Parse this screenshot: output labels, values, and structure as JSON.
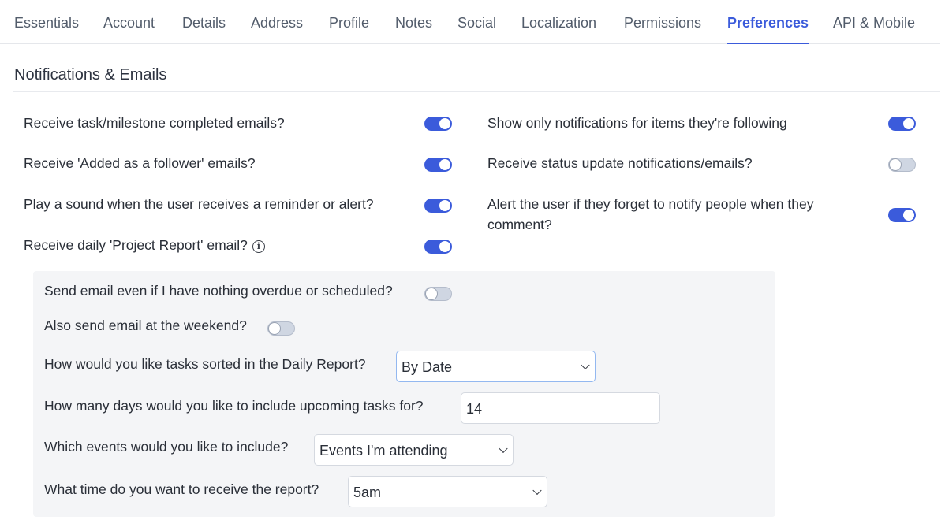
{
  "tabs": [
    {
      "label": "Essentials"
    },
    {
      "label": "Account"
    },
    {
      "label": "Details"
    },
    {
      "label": "Address"
    },
    {
      "label": "Profile"
    },
    {
      "label": "Notes"
    },
    {
      "label": "Social"
    },
    {
      "label": "Localization"
    },
    {
      "label": "Permissions"
    },
    {
      "label": "Preferences",
      "active": true
    },
    {
      "label": "API & Mobile"
    }
  ],
  "section": {
    "title": "Notifications & Emails"
  },
  "left_settings": [
    {
      "label": "Receive task/milestone completed emails?",
      "enabled": true
    },
    {
      "label": "Receive 'Added as a follower' emails?",
      "enabled": true
    },
    {
      "label": "Play a sound when the user receives a reminder or alert?",
      "enabled": true
    },
    {
      "label": "Receive daily 'Project Report' email?",
      "enabled": true
    }
  ],
  "right_settings": [
    {
      "label": "Show only notifications for items they're following",
      "enabled": true
    },
    {
      "label": "Receive status update notifications/emails?",
      "enabled": false
    },
    {
      "label": "Alert the user if they forget to notify people when they comment?",
      "enabled": true
    }
  ],
  "daily_report": {
    "nothing_overdue": {
      "label": "Send email even if I have nothing overdue or scheduled?",
      "enabled": false
    },
    "weekend": {
      "label": "Also send email at the weekend?",
      "enabled": false
    },
    "sort": {
      "label": "How would you like tasks sorted in the Daily Report?",
      "value": "By Date"
    },
    "upcoming_days": {
      "label": "How many days would you like to include upcoming tasks for?",
      "value": "14"
    },
    "events": {
      "label": "Which events would you like to include?",
      "value": "Events I'm attending"
    },
    "time": {
      "label": "What time do you want to receive the report?",
      "value": "5am"
    }
  },
  "colors": {
    "accent": "#3b5bdb",
    "toggle_off": "#cfd6e2",
    "panel_bg": "#f4f5f7"
  }
}
